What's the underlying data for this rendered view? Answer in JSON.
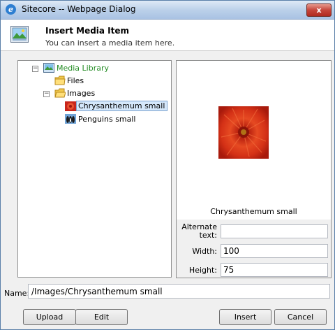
{
  "window": {
    "title": "Sitecore -- Webpage Dialog",
    "close_label": "x",
    "ie_icon": "e"
  },
  "header": {
    "title": "Insert Media Item",
    "subtitle": "You can insert a media item here."
  },
  "tree": {
    "root": {
      "label": "Media Library",
      "toggle": "−"
    },
    "files": {
      "label": "Files"
    },
    "images": {
      "label": "Images",
      "toggle": "−"
    },
    "items": [
      {
        "label": "Chrysanthemum small",
        "selected": true
      },
      {
        "label": "Penguins small",
        "selected": false
      }
    ]
  },
  "preview": {
    "caption": "Chrysanthemum small"
  },
  "properties": {
    "alt_label_1": "Alternate",
    "alt_label_2": "text:",
    "alt_value": "",
    "width_label": "Width:",
    "width_value": "100",
    "height_label": "Height:",
    "height_value": "75"
  },
  "name": {
    "label": "Name:",
    "value": "/Images/Chrysanthemum small"
  },
  "buttons": {
    "upload": "Upload",
    "edit": "Edit",
    "insert": "Insert",
    "cancel": "Cancel"
  },
  "colors": {
    "tree_link": "#228b22",
    "selection": "#d5e8fb"
  }
}
